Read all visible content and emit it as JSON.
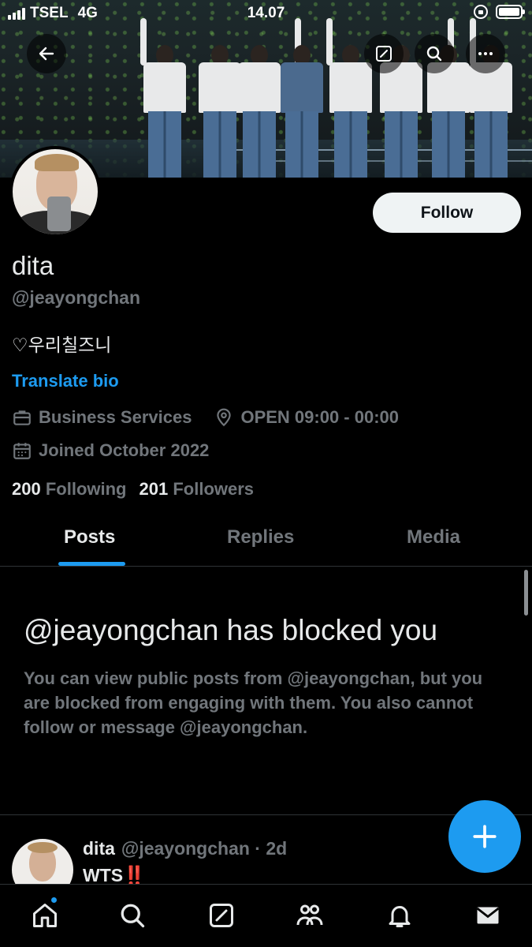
{
  "status_bar": {
    "carrier": "TSEL",
    "network": "4G",
    "time": "14.07"
  },
  "profile": {
    "display_name": "dita",
    "handle": "@jeayongchan",
    "bio": "♡우리칠즈니",
    "translate_label": "Translate bio",
    "category": "Business Services",
    "location": "OPEN 09:00 - 00:00",
    "joined": "Joined October 2022",
    "following_count": "200",
    "following_label": "Following",
    "followers_count": "201",
    "followers_label": "Followers",
    "follow_button": "Follow"
  },
  "tabs": [
    {
      "label": "Posts",
      "active": true
    },
    {
      "label": "Replies",
      "active": false
    },
    {
      "label": "Media",
      "active": false
    }
  ],
  "blocked": {
    "title": "@jeayongchan has blocked you",
    "body": "You can view public posts from @jeayongchan, but you are blocked from engaging with them. You also cannot follow or message @jeayongchan."
  },
  "post": {
    "name": "dita",
    "handle_time": "@jeayongchan · 2d",
    "text": "WTS",
    "emoji": "‼️"
  },
  "icons": {
    "top": [
      "back-arrow-icon",
      "compose-icon",
      "search-icon",
      "more-icon"
    ],
    "meta": [
      "briefcase-icon",
      "location-pin-icon",
      "calendar-icon"
    ],
    "bottom_nav": [
      "home-icon",
      "search-icon",
      "grok-icon",
      "communities-icon",
      "notifications-icon",
      "messages-icon"
    ],
    "fab": "plus-icon"
  },
  "colors": {
    "accent": "#1d9bf0",
    "background": "#000000",
    "secondary_text": "#71767b",
    "primary_text": "#e7e9ea",
    "emoji_red": "#f4212e"
  }
}
